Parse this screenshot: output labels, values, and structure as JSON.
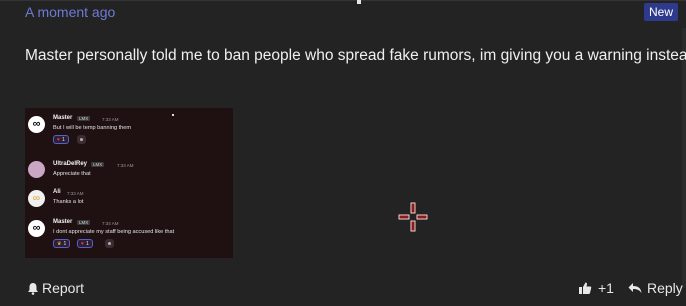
{
  "post": {
    "timestamp": "A moment ago",
    "badge": "New",
    "message": "Master personally told me to ban people who spread fake rumors, im giving you a warning instead"
  },
  "embedded_screenshot": {
    "messages": [
      {
        "author": "Master",
        "tag": "LMX",
        "time": "7:33 AM",
        "text": "But I will be temp banning them",
        "reactions": [
          {
            "icon": "heart-icon",
            "count": "1"
          },
          {
            "icon": "emoji-icon",
            "count": ""
          }
        ]
      },
      {
        "author": "UltraDelRey",
        "tag": "LMX",
        "time": "7:33 AM",
        "text": "Appreciate that",
        "reactions": []
      },
      {
        "author": "Ali",
        "tag": "",
        "time": "7:33 AM",
        "text": "Thanks a lot",
        "reactions": []
      },
      {
        "author": "Master",
        "tag": "LMX",
        "time": "7:34 AM",
        "text": "I dont appreciate my staff being accused like that",
        "reactions": [
          {
            "icon": "crown-icon",
            "count": "1"
          },
          {
            "icon": "heart-icon",
            "count": "1"
          },
          {
            "icon": "emoji-icon",
            "count": ""
          }
        ]
      }
    ]
  },
  "actions": {
    "report_label": "Report",
    "like_count": "+1",
    "reply_label": "Reply"
  },
  "colors": {
    "background": "#232323",
    "accent": "#6c7bd6",
    "badge": "#2e3a8c"
  }
}
